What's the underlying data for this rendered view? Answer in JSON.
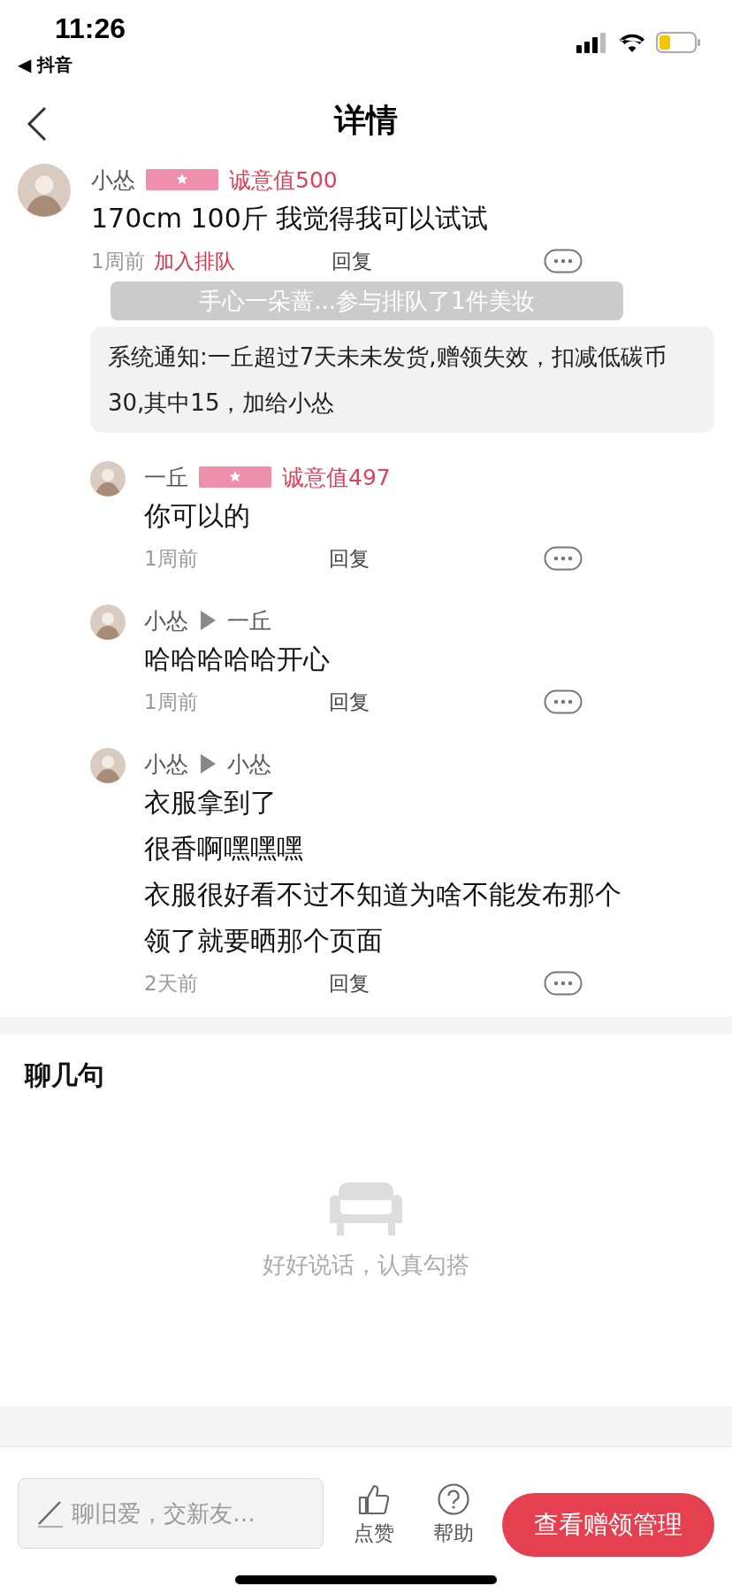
{
  "status_bar": {
    "time": "11:26",
    "back_app": "◀ 抖音"
  },
  "header": {
    "title": "详情"
  },
  "comment": {
    "author": "小怂",
    "sincerity": "诚意值500",
    "text": "170cm 100斤 我觉得我可以试试",
    "time": "1周前",
    "action": "加入排队",
    "reply": "回复"
  },
  "toast": "手心一朵蔷...参与排队了1件美妆",
  "notice": "系统通知:一丘超过7天未未发货,赠领失效，扣减低碳币30,其中15，加给小怂",
  "replies": [
    {
      "kind": "badge",
      "author": "一丘",
      "sincerity": "诚意值497",
      "lines": [
        "你可以的"
      ],
      "time": "1周前",
      "reply": "回复"
    },
    {
      "kind": "reply_to",
      "author": "小怂",
      "target": "一丘",
      "lines": [
        "哈哈哈哈哈开心"
      ],
      "time": "1周前",
      "reply": "回复"
    },
    {
      "kind": "reply_to",
      "author": "小怂",
      "target": "小怂",
      "lines": [
        "衣服拿到了",
        "很香啊嘿嘿嘿",
        "衣服很好看不过不知道为啥不能发布那个",
        "领了就要晒那个页面"
      ],
      "time": "2天前",
      "reply": "回复"
    }
  ],
  "chat": {
    "title": "聊几句",
    "empty_text": "好好说话，认真勾搭"
  },
  "bottom_bar": {
    "placeholder": "聊旧爱，交新友…",
    "actions": [
      {
        "kind": "like",
        "label": "点赞"
      },
      {
        "kind": "help",
        "label": "帮助"
      }
    ],
    "button": "查看赠领管理"
  }
}
